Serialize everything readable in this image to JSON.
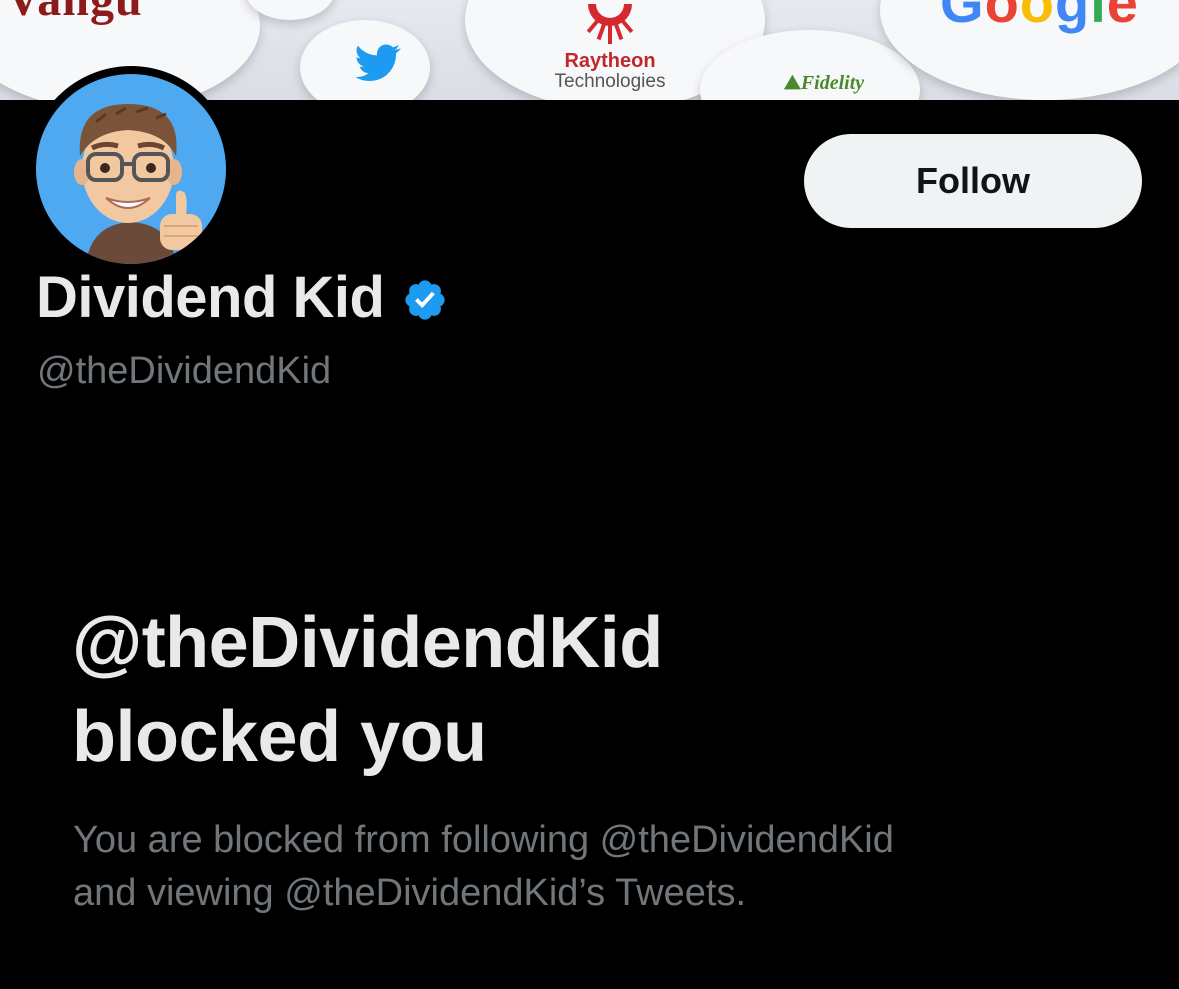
{
  "banner": {
    "logos": {
      "vanguard": "Vangu",
      "twitter": "twitter-bird-icon",
      "raytheon_name": "Raytheon",
      "raytheon_sub": "Technologies",
      "fidelity": "Fidelity",
      "google": "Google"
    }
  },
  "profile": {
    "display_name": "Dividend Kid",
    "handle": "@theDividendKid",
    "verified": true,
    "avatar_icon": "memoji-avatar-thumbs-up"
  },
  "actions": {
    "follow_label": "Follow"
  },
  "blocked": {
    "title_line1": "@theDividendKid",
    "title_line2": "blocked you",
    "desc_line1": "You are blocked from following @theDividendKid",
    "desc_line2": "and viewing @theDividendKid’s Tweets."
  },
  "colors": {
    "background": "#000000",
    "primary_text": "#e7e9ea",
    "secondary_text": "#71767b",
    "verified_blue": "#1d9bf0",
    "button_bg": "#eff3f4"
  }
}
